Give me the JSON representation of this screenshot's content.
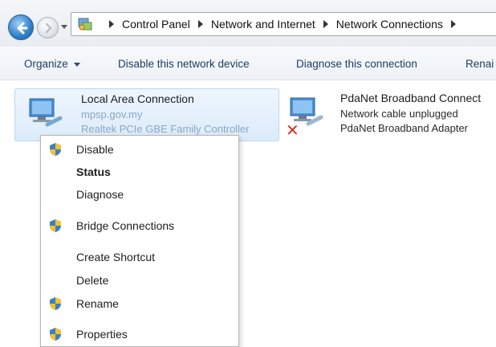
{
  "window": {
    "breadcrumb": [
      "Control Panel",
      "Network and Internet",
      "Network Connections"
    ]
  },
  "icons": {
    "back": "back-arrow-icon",
    "forward": "forward-arrow-icon",
    "control_panel": "control-panel-icon",
    "network_adapter": "network-adapter-icon",
    "disconnected": "red-x-icon",
    "shield": "uac-shield-icon"
  },
  "toolbar": {
    "organize": "Organize",
    "disable_device": "Disable this network device",
    "diagnose": "Diagnose this connection",
    "rename": "Renai"
  },
  "connections": [
    {
      "name": "Local Area Connection",
      "line1": "mpsp.gov.my",
      "line2": "Realtek PCIe GBE Family Controller"
    },
    {
      "name": "PdaNet Broadband Connect",
      "line1": "Network cable unplugged",
      "line2": "PdaNet Broadband Adapter"
    }
  ],
  "context_menu": {
    "items": [
      {
        "label": "Disable",
        "shield": true,
        "bold": false
      },
      {
        "label": "Status",
        "shield": false,
        "bold": true
      },
      {
        "label": "Diagnose",
        "shield": false,
        "bold": false
      },
      {
        "label": "Bridge Connections",
        "shield": true,
        "bold": false
      },
      {
        "label": "Create Shortcut",
        "shield": false,
        "bold": false
      },
      {
        "label": "Delete",
        "shield": false,
        "bold": false
      },
      {
        "label": "Rename",
        "shield": true,
        "bold": false
      },
      {
        "label": "Properties",
        "shield": true,
        "bold": false
      }
    ]
  },
  "colors": {
    "accent_blue": "#2f7fc8",
    "selection_bg": "#dcebfa",
    "error_red": "#d2332b",
    "toolbar_text": "#1f3a5f"
  }
}
